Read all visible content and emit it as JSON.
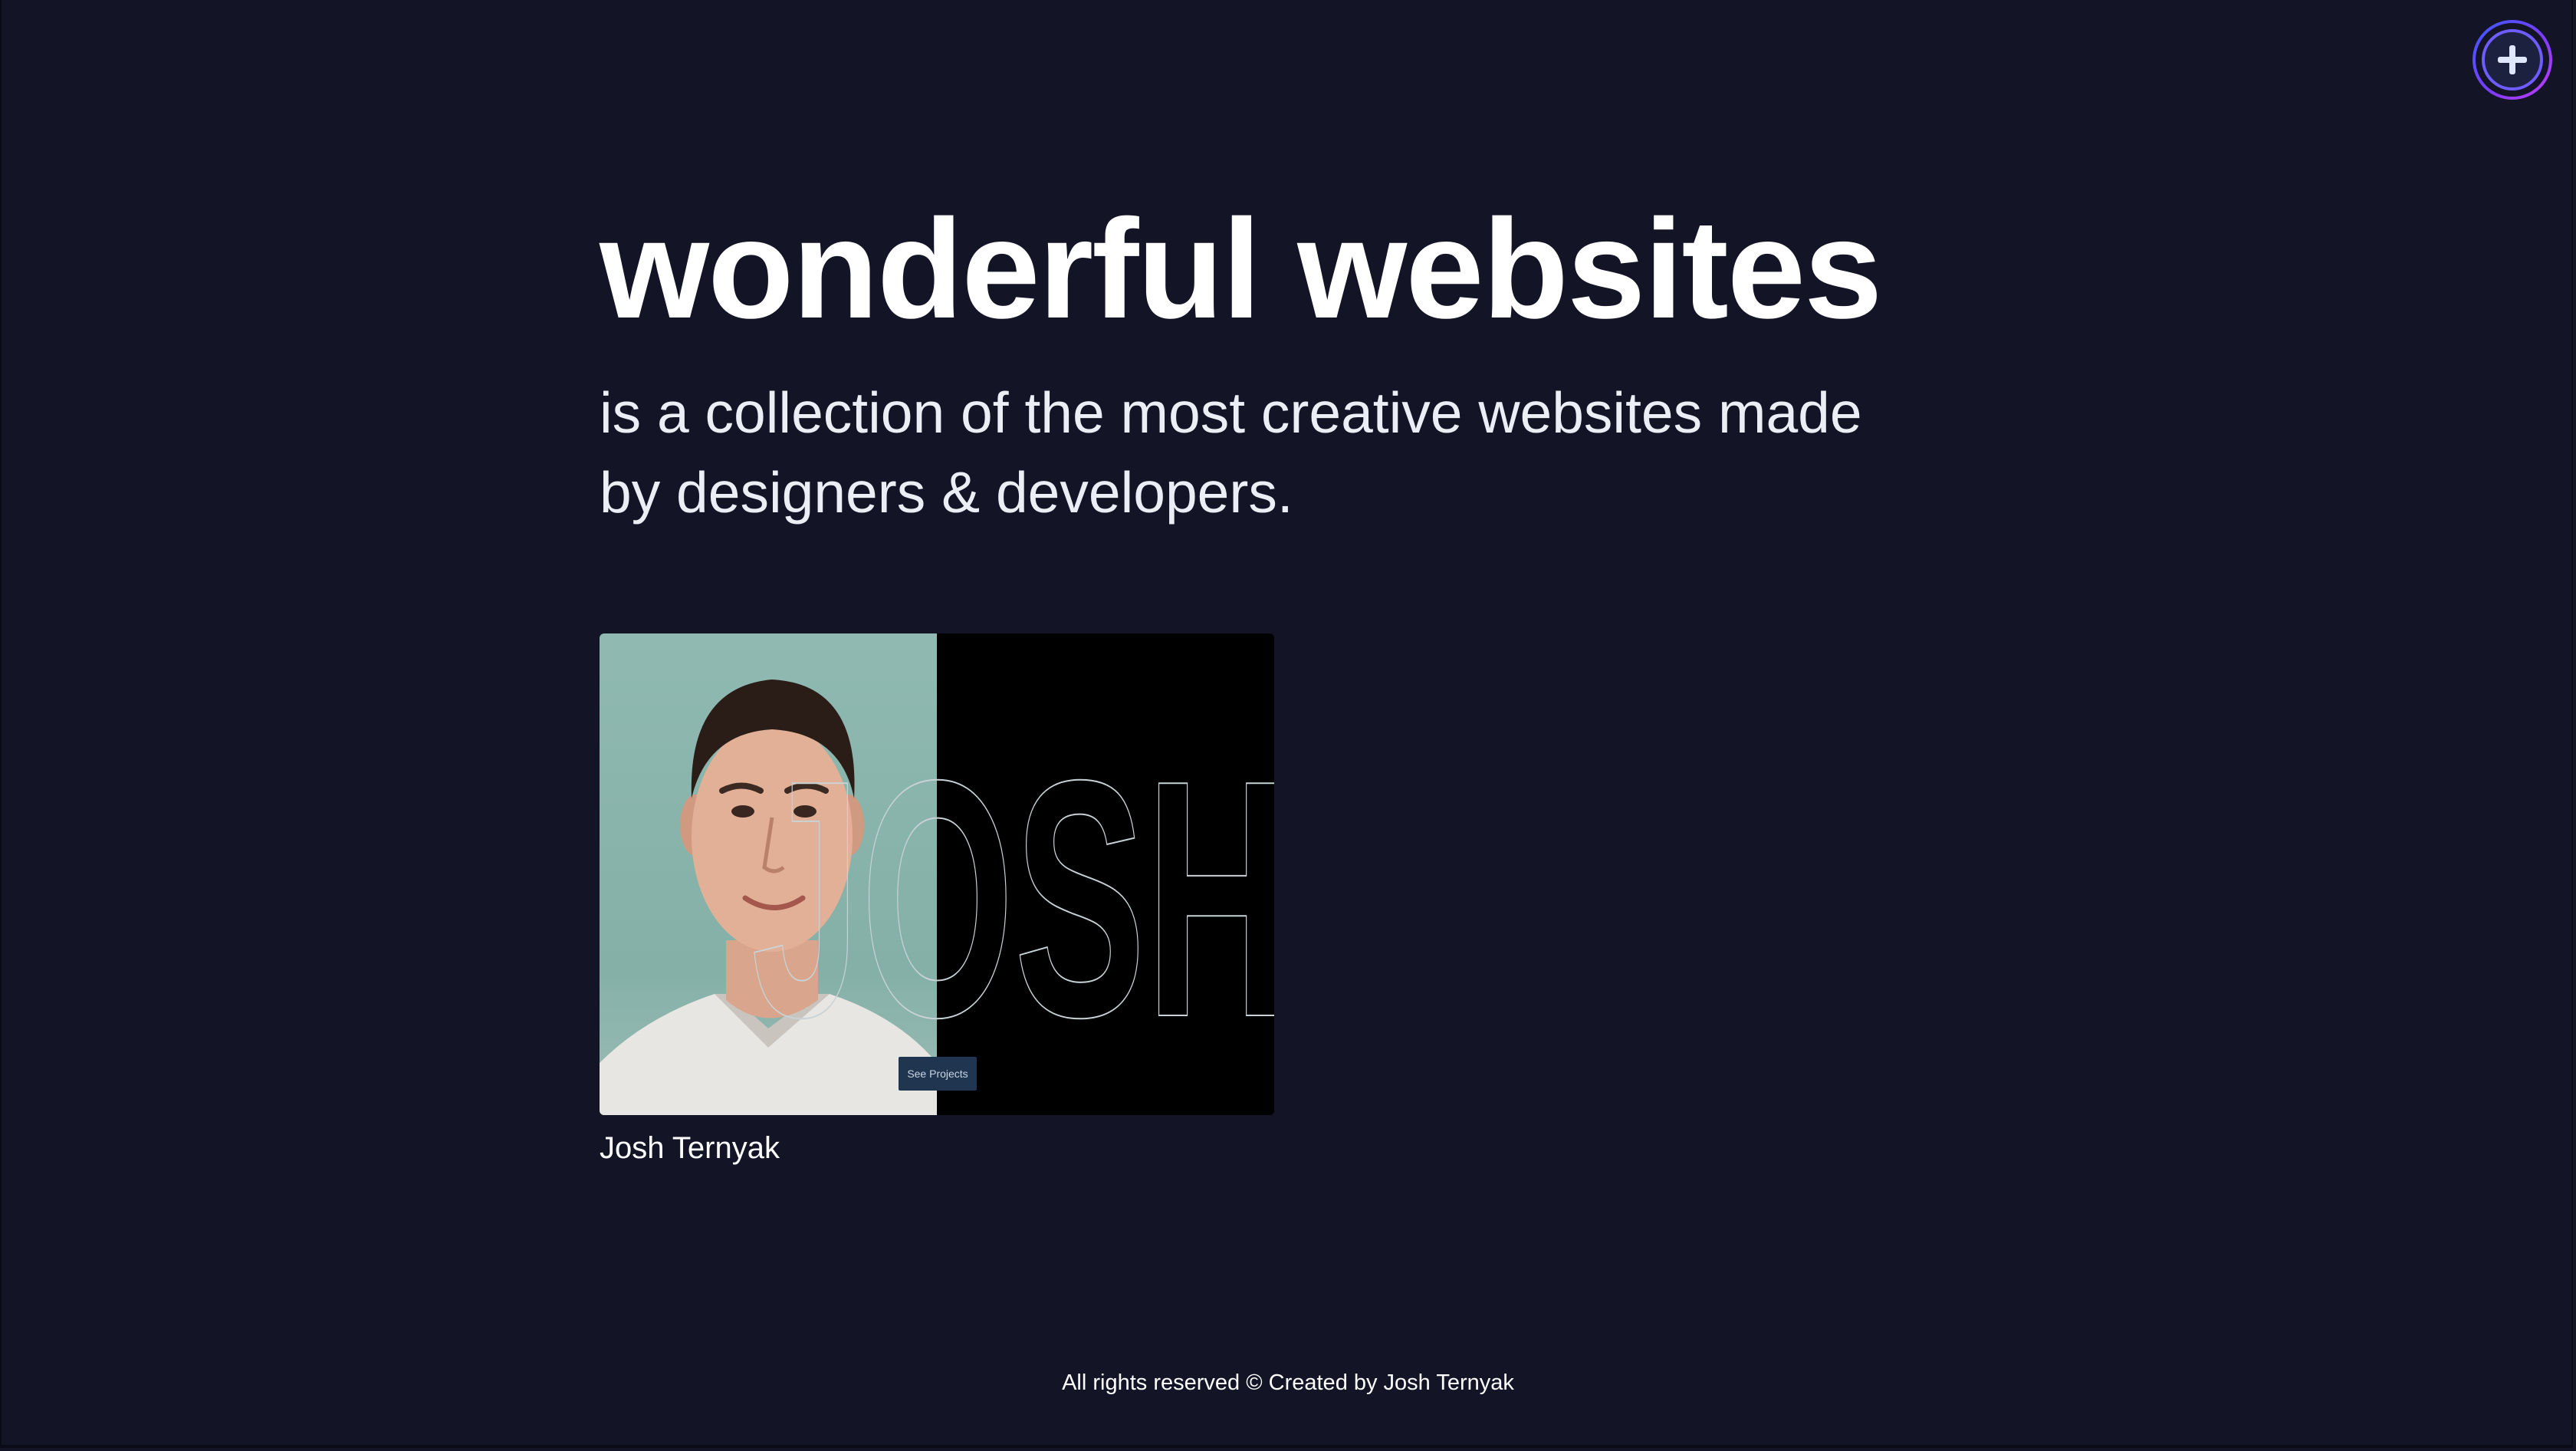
{
  "hero": {
    "title": "wonderful websites",
    "subtitle": "is a collection of the most creative websites made by designers & developers."
  },
  "add_button": {
    "icon": "plus-icon",
    "colors": [
      "#3b5bff",
      "#7b3cff",
      "#c43cff"
    ]
  },
  "cards": [
    {
      "thumbnail_overlay_text": "JOSH",
      "cta_label": "See Projects",
      "name": "Josh Ternyak"
    }
  ],
  "footer": {
    "text": "All rights reserved © Created by Josh Ternyak"
  },
  "colors": {
    "background": "#131527",
    "text": "#ffffff"
  }
}
